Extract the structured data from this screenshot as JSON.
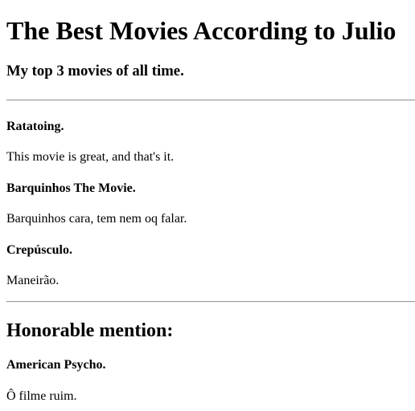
{
  "page": {
    "title": "The Best Movies According to Julio",
    "subtitle": "My top 3 movies of all time."
  },
  "movies": [
    {
      "name": "Ratatoing.",
      "description": "This movie is great, and that's it."
    },
    {
      "name": "Barquinhos The Movie.",
      "description": "Barquinhos cara, tem nem oq falar."
    },
    {
      "name": "Crepúsculo.",
      "description": "Maneirão."
    }
  ],
  "honorable": {
    "heading": "Honorable mention:",
    "name": "American Psycho.",
    "description": "Ô filme ruim."
  }
}
